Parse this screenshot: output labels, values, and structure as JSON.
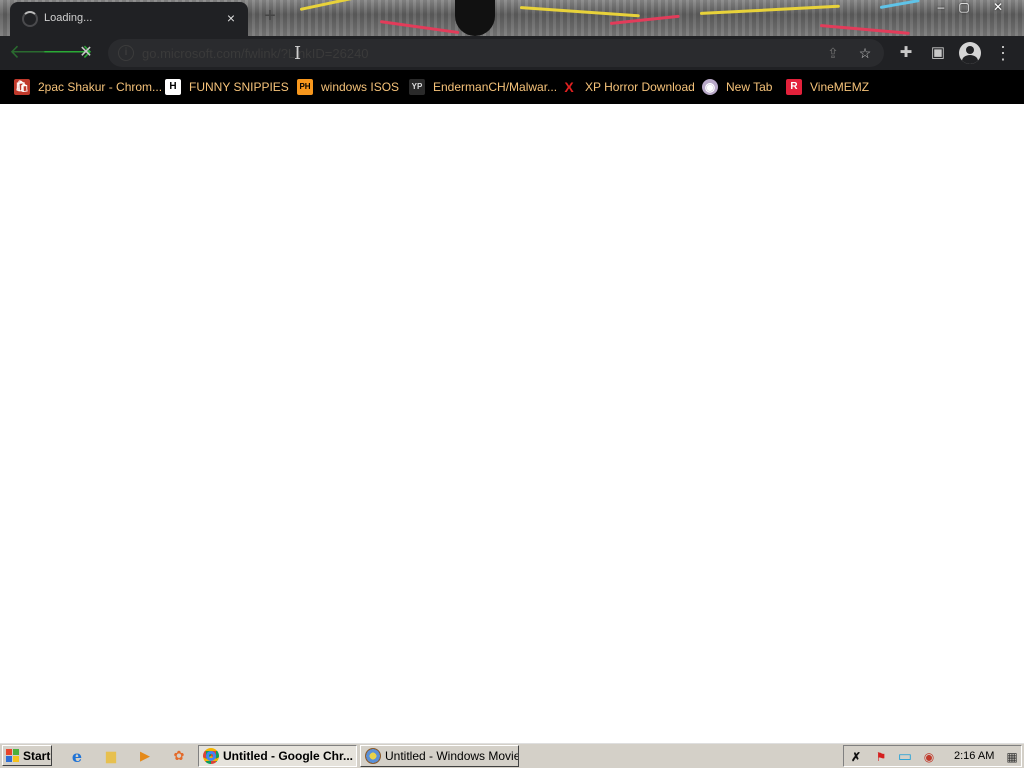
{
  "browser": {
    "tab": {
      "title": "Loading...",
      "close_glyph": "×"
    },
    "new_tab_glyph": "+",
    "window_controls": [
      "–",
      "▢",
      "✕"
    ],
    "nav": {
      "back_glyph": "🡐",
      "forward_glyph": "🡒",
      "stop_glyph": "✕"
    },
    "address": {
      "url": "go.microsoft.com/fwlink/?LinkID=26240",
      "info_glyph": "i"
    },
    "toolbar_icons": {
      "share": "⇪",
      "star": "☆",
      "extensions": "✚",
      "side_panel": "▣",
      "menu": "⋮"
    },
    "bookmarks": [
      {
        "label": "2pac Shakur - Chrom...",
        "icon": "shopping-bag-icon",
        "glyph": "🛍",
        "bg": "#c0392b",
        "fg": "#fff"
      },
      {
        "label": "FUNNY SNIPPIES",
        "icon": "h-letter-icon",
        "glyph": "H",
        "bg": "#ffffff",
        "fg": "#000"
      },
      {
        "label": "windows ISOS",
        "icon": "ph-logo-icon",
        "glyph": "PH",
        "bg": "#f7971d",
        "fg": "#000"
      },
      {
        "label": "EndermanCH/Malwar...",
        "icon": "yp-logo-icon",
        "glyph": "YP",
        "bg": "#2a2a2a",
        "fg": "#ddd"
      },
      {
        "label": "XP Horror Download",
        "icon": "red-x-icon",
        "glyph": "X",
        "bg": "transparent",
        "fg": "#e02020"
      },
      {
        "label": "New Tab",
        "icon": "globe-icon",
        "glyph": "◉",
        "bg": "#b9a9c9",
        "fg": "#fff"
      },
      {
        "label": "VineMEMZ",
        "icon": "r-logo-icon",
        "glyph": "R",
        "bg": "#e3213b",
        "fg": "#fff"
      }
    ]
  },
  "taskbar": {
    "start_label": "Start",
    "quick_launch": [
      {
        "name": "internet-explorer-icon",
        "glyph": "e",
        "color": "#1f73d6"
      },
      {
        "name": "folder-icon",
        "glyph": "▆",
        "color": "#e7c04f"
      },
      {
        "name": "media-player-icon",
        "glyph": "▶",
        "color": "#e58a1a"
      },
      {
        "name": "app-icon",
        "glyph": "✿",
        "color": "#e36a2a"
      }
    ],
    "tasks": [
      {
        "label": "Untitled - Google Chr...",
        "active": true,
        "icon": "chrome-icon"
      },
      {
        "label": "Untitled - Windows Movie...",
        "active": false,
        "icon": "movie-maker-icon"
      }
    ],
    "tray": [
      {
        "name": "antivirus-icon",
        "glyph": "✗",
        "color": "#111"
      },
      {
        "name": "flag-icon",
        "glyph": "⚑",
        "color": "#d52020"
      },
      {
        "name": "monitor-icon",
        "glyph": "▭",
        "color": "#1a9fd8"
      },
      {
        "name": "record-icon",
        "glyph": "◉",
        "color": "#c0392b"
      },
      {
        "name": "display-icon",
        "glyph": "▦",
        "color": "#333"
      }
    ],
    "clock": "2:16 AM"
  },
  "colors": {
    "bookmark_text": "#f6c37a",
    "toolbar_bg": "#202124",
    "forward_arrow": "#2aaa35"
  }
}
